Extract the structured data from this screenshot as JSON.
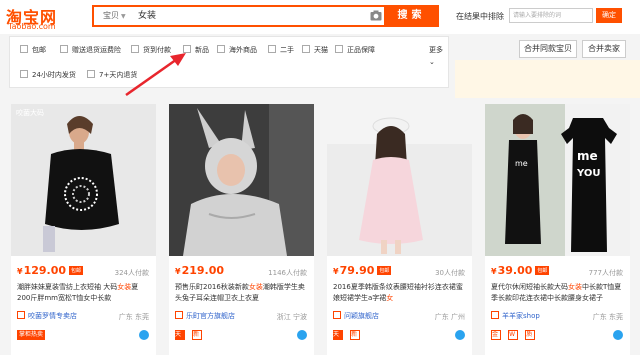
{
  "header": {
    "logo_text": "淘宝网",
    "logo_domain": "Taobao.com",
    "search_type": "宝贝",
    "search_query": "女装",
    "search_button": "搜索",
    "within_label": "在结果中排除",
    "within_placeholder": "请输入要排除的词",
    "within_button": "确定"
  },
  "filters": {
    "row1": [
      {
        "label": "包邮",
        "checked": false
      },
      {
        "label": "赠送退货运费险",
        "checked": false
      },
      {
        "label": "货到付款",
        "checked": false
      },
      {
        "label": "新品",
        "checked": false
      },
      {
        "label": "海外商品",
        "checked": false
      },
      {
        "label": "二手",
        "checked": false
      },
      {
        "label": "天猫",
        "checked": false
      },
      {
        "label": "正品保障",
        "checked": false
      }
    ],
    "row2": [
      {
        "label": "24小时内发货",
        "checked": false
      },
      {
        "label": "7+天内退货",
        "checked": false
      }
    ],
    "more_label": "更多"
  },
  "sort_buttons": [
    "合并同款宝贝",
    "合并卖家"
  ],
  "products": [
    {
      "price": "129.00",
      "tag": "包邮",
      "sales": "324人付款",
      "title_pre": "潮胖妹妹夏装雪纺上衣短袖 大码",
      "title_hl": "女装",
      "title_post": "夏 200斤胖mm宽松T恤女中长款",
      "shop": "咬菌罗情专卖店",
      "location": "广东 东莞",
      "badges": [
        "掌柜热卖"
      ],
      "watermark": "咬菌大码"
    },
    {
      "price": "219.00",
      "tag": "",
      "sales": "1146人付款",
      "title_pre": "预售乐町2016秋装新款",
      "title_hl": "女装",
      "title_post": "潮韩版学生卖头兔子耳朵连帽卫衣上衣夏",
      "shop": "乐町官方旗舰店",
      "location": "浙江 宁波",
      "badges": [
        "天",
        "新"
      ],
      "watermark": ""
    },
    {
      "price": "79.90",
      "tag": "包邮",
      "sales": "30人付款",
      "title_pre": "2016夏季韩版条纹表腰短袖衬衫连衣裙蜜娘短裙学生a字裙",
      "title_hl": "女",
      "title_post": "",
      "shop": "问颖旗舰店",
      "location": "广东 广州",
      "badges": [
        "天",
        "新"
      ],
      "watermark": ""
    },
    {
      "price": "39.00",
      "tag": "包邮",
      "sales": "777人付款",
      "title_pre": "夏代尔休闲短袖长款大码",
      "title_hl": "女装",
      "title_post": "中长款T恤夏季长款印花连衣裙中长款腰身女裙子",
      "shop": "羊羊家shop",
      "location": "广东 东莞",
      "badges": [
        "金",
        "W",
        "质"
      ],
      "watermark": ""
    }
  ],
  "colors": {
    "accent": "#ff5000",
    "price": "#ff4400",
    "link": "#3366cc"
  }
}
